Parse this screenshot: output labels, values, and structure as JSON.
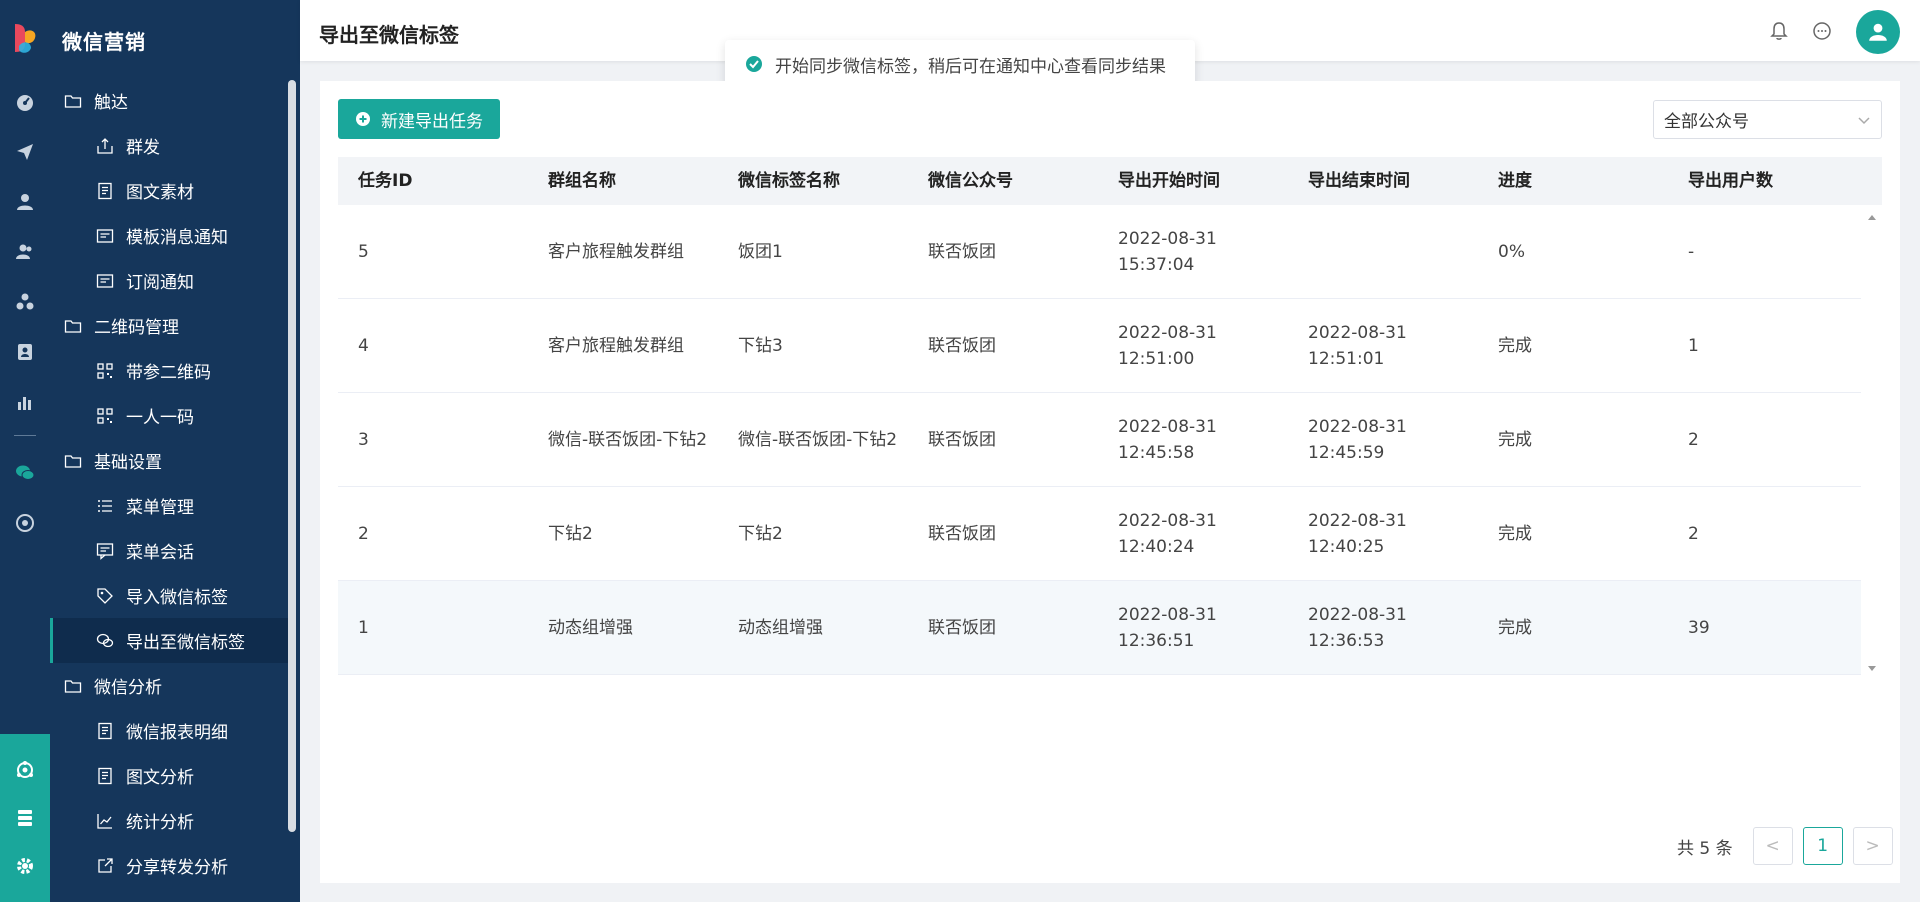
{
  "sidebar": {
    "title": "微信营销",
    "items": [
      {
        "label": "触达",
        "type": "group",
        "icon": "folder-icon"
      },
      {
        "label": "群发",
        "type": "sub",
        "icon": "mass-send-icon"
      },
      {
        "label": "图文素材",
        "type": "sub",
        "icon": "document-icon"
      },
      {
        "label": "模板消息通知",
        "type": "sub",
        "icon": "template-icon"
      },
      {
        "label": "订阅通知",
        "type": "sub",
        "icon": "template-icon"
      },
      {
        "label": "二维码管理",
        "type": "group",
        "icon": "folder-icon"
      },
      {
        "label": "带参二维码",
        "type": "sub",
        "icon": "qrcode-icon"
      },
      {
        "label": "一人一码",
        "type": "sub",
        "icon": "qrcode-icon"
      },
      {
        "label": "基础设置",
        "type": "group",
        "icon": "folder-icon"
      },
      {
        "label": "菜单管理",
        "type": "sub",
        "icon": "list-icon"
      },
      {
        "label": "菜单会话",
        "type": "sub",
        "icon": "chat-icon"
      },
      {
        "label": "导入微信标签",
        "type": "sub",
        "icon": "tag-icon"
      },
      {
        "label": "导出至微信标签",
        "type": "sub",
        "icon": "wechat-icon",
        "active": true
      },
      {
        "label": "微信分析",
        "type": "group",
        "icon": "folder-icon"
      },
      {
        "label": "微信报表明细",
        "type": "sub",
        "icon": "document-icon"
      },
      {
        "label": "图文分析",
        "type": "sub",
        "icon": "document-icon"
      },
      {
        "label": "统计分析",
        "type": "sub",
        "icon": "chart-icon"
      },
      {
        "label": "分享转发分析",
        "type": "sub",
        "icon": "share-icon"
      }
    ]
  },
  "header": {
    "title": "导出至微信标签"
  },
  "toast": {
    "message": "开始同步微信标签，稍后可在通知中心查看同步结果"
  },
  "toolbar": {
    "new_task_label": "新建导出任务",
    "account_select": "全部公众号"
  },
  "table": {
    "columns": [
      "任务ID",
      "群组名称",
      "微信标签名称",
      "微信公众号",
      "导出开始时间",
      "导出结束时间",
      "进度",
      "导出用户数"
    ],
    "rows": [
      {
        "id": "5",
        "group": "客户旅程触发群组",
        "tag": "饭团1",
        "account": "联否饭团",
        "start_date": "2022-08-31",
        "start_time": "15:37:04",
        "end_date": "",
        "end_time": "",
        "progress": "0%",
        "users": "-"
      },
      {
        "id": "4",
        "group": "客户旅程触发群组",
        "tag": "下钻3",
        "account": "联否饭团",
        "start_date": "2022-08-31",
        "start_time": "12:51:00",
        "end_date": "2022-08-31",
        "end_time": "12:51:01",
        "progress": "完成",
        "users": "1"
      },
      {
        "id": "3",
        "group": "微信-联否饭团-下钻2",
        "tag": "微信-联否饭团-下钻2",
        "account": "联否饭团",
        "start_date": "2022-08-31",
        "start_time": "12:45:58",
        "end_date": "2022-08-31",
        "end_time": "12:45:59",
        "progress": "完成",
        "users": "2"
      },
      {
        "id": "2",
        "group": "下钻2",
        "tag": "下钻2",
        "account": "联否饭团",
        "start_date": "2022-08-31",
        "start_time": "12:40:24",
        "end_date": "2022-08-31",
        "end_time": "12:40:25",
        "progress": "完成",
        "users": "2"
      },
      {
        "id": "1",
        "group": "动态组增强",
        "tag": "动态组增强",
        "account": "联否饭团",
        "start_date": "2022-08-31",
        "start_time": "12:36:51",
        "end_date": "2022-08-31",
        "end_time": "12:36:53",
        "progress": "完成",
        "users": "39"
      }
    ]
  },
  "pagination": {
    "total": "共 5 条",
    "current_page": "1",
    "prev": "<",
    "next": ">"
  },
  "colors": {
    "sidebar_bg": "#15365b",
    "accent": "#1aa79b"
  }
}
